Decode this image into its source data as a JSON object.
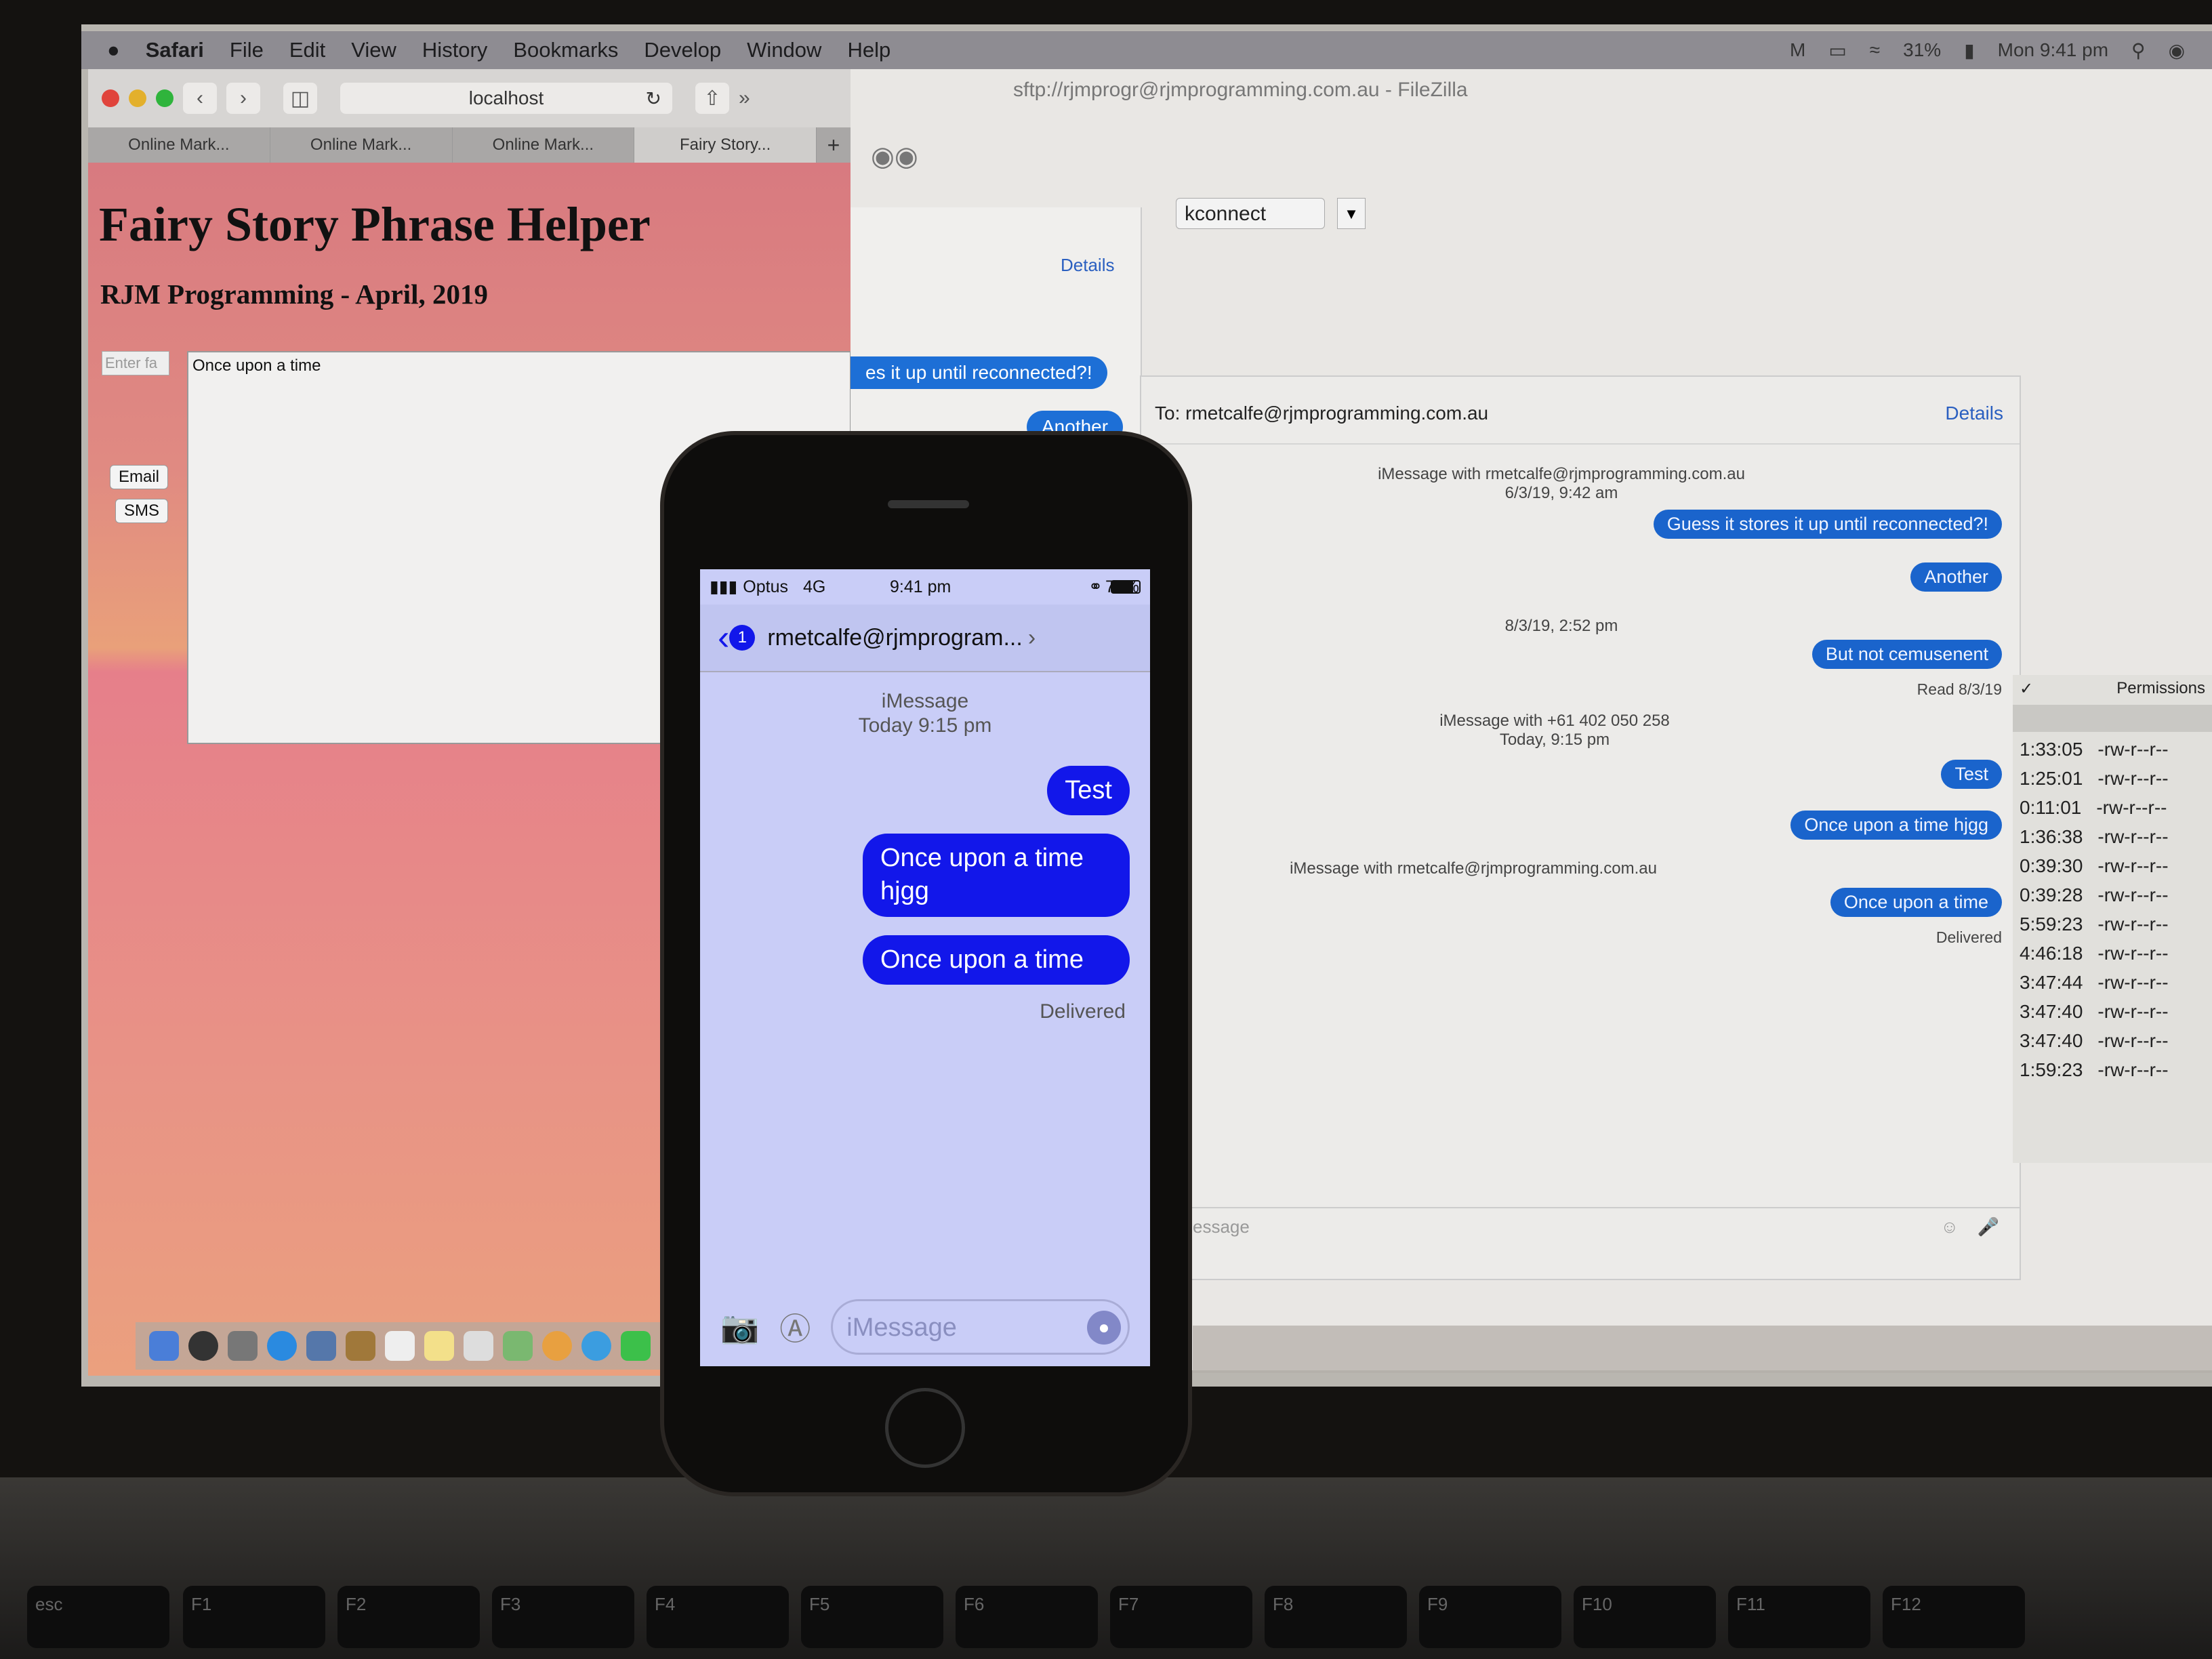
{
  "menubar": {
    "app": "Safari",
    "items": [
      "File",
      "Edit",
      "View",
      "History",
      "Bookmarks",
      "Develop",
      "Window",
      "Help"
    ],
    "battery": "31%",
    "clock": "Mon 9:41 pm"
  },
  "safari": {
    "url": "localhost",
    "tabs": [
      "Online Mark...",
      "Online Mark...",
      "Online Mark...",
      "Fairy Story..."
    ],
    "new_tab": "+",
    "page": {
      "title": "Fairy Story Phrase Helper",
      "subtitle": "RJM Programming - April, 2019",
      "enter_placeholder": "Enter fa",
      "textarea_value": "Once upon a time",
      "email_button": "Email",
      "sms_button": "SMS"
    }
  },
  "filezilla": {
    "title": "sftp://rjmprogr@rjmprogramming.com.au - FileZilla",
    "quickconnect": "kconnect",
    "permissions_header": "Permissions",
    "rows": [
      [
        "1:33:05",
        "-rw-r--r--"
      ],
      [
        "1:25:01",
        "-rw-r--r--"
      ],
      [
        "0:11:01",
        "-rw-r--r--"
      ],
      [
        "1:36:38",
        "-rw-r--r--"
      ],
      [
        "0:39:30",
        "-rw-r--r--"
      ],
      [
        "0:39:28",
        "-rw-r--r--"
      ],
      [
        "5:59:23",
        "-rw-r--r--"
      ],
      [
        "4:46:18",
        "-rw-r--r--"
      ],
      [
        "3:47:44",
        "-rw-r--r--"
      ],
      [
        "3:47:40",
        "-rw-r--r--"
      ],
      [
        "3:47:40",
        "-rw-r--r--"
      ],
      [
        "1:59:23",
        "-rw-r--r--"
      ]
    ]
  },
  "messages_small": {
    "details": "Details",
    "bubbles": [
      "es it up until reconnected?!",
      "Another"
    ]
  },
  "messages": {
    "to_label": "To:",
    "to": "rmetcalfe@rjmprogramming.com.au",
    "details": "Details",
    "meta1": "iMessage with rmetcalfe@rjmprogramming.com.au",
    "date1": "6/3/19, 9:42 am",
    "b1": "Guess it stores it up until reconnected?!",
    "b2": "Another",
    "date2": "8/3/19, 2:52 pm",
    "b3": "But not cemusenent",
    "read": "Read 8/3/19",
    "meta2": "iMessage with +61 402 050 258",
    "date3": "Today, 9:15 pm",
    "b4": "Test",
    "b5": "Once upon a time hjgg",
    "meta3": "iMessage with rmetcalfe@rjmprogramming.com.au",
    "b6": "Once upon a time",
    "delivered": "Delivered",
    "input_placeholder": "essage"
  },
  "phone": {
    "carrier": "Optus",
    "network": "4G",
    "time": "9:41 pm",
    "battery": "78%",
    "battery_level": 0.78,
    "back_badge": "1",
    "contact": "rmetcalfe@rjmprogram...",
    "service": "iMessage",
    "timestamp": "Today 9:15 pm",
    "bubbles": [
      "Test",
      "Once upon a time hjgg",
      "Once upon a time"
    ],
    "delivered": "Delivered",
    "input_placeholder": "iMessage"
  },
  "keyboard": {
    "keys": [
      "esc",
      "F1",
      "F2",
      "F3",
      "F4",
      "F5",
      "F6",
      "F7",
      "F8",
      "F9",
      "F10",
      "F11",
      "F12"
    ]
  },
  "colors": {
    "imessage_blue": "#1a64cc",
    "phone_bubble": "#1217ea",
    "page_pink": "#e08a82"
  }
}
